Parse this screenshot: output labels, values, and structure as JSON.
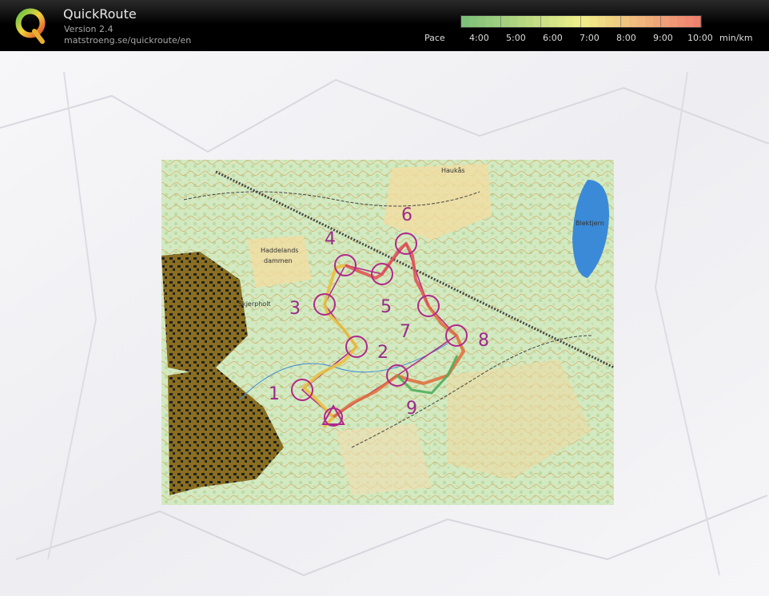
{
  "app": {
    "name": "QuickRoute",
    "version": "Version 2.4",
    "url": "matstroeng.se/quickroute/en"
  },
  "pace_scale": {
    "label": "Pace",
    "ticks": [
      "4:00",
      "5:00",
      "6:00",
      "7:00",
      "8:00",
      "9:00",
      "10:00"
    ],
    "unit": "min/km",
    "colors": {
      "fast": "#7ec07a",
      "mid": "#f0ef8a",
      "slow": "#f08070"
    }
  },
  "map": {
    "place_labels": {
      "haukas": "Haukås",
      "blektjern": "Blektjern",
      "haddelands": "Haddelands",
      "dammen": "dammen",
      "skjerpholt": "Skjerpholt"
    },
    "controls": [
      {
        "label": "1"
      },
      {
        "label": "2"
      },
      {
        "label": "3"
      },
      {
        "label": "4"
      },
      {
        "label": "5"
      },
      {
        "label": "6"
      },
      {
        "label": "7"
      },
      {
        "label": "8"
      },
      {
        "label": "9"
      }
    ],
    "colors": {
      "course": "#b0288c",
      "route": "#e8c040",
      "route_slow": "#e05050",
      "water": "#2f7fcf",
      "urban": "#7a6420"
    }
  }
}
